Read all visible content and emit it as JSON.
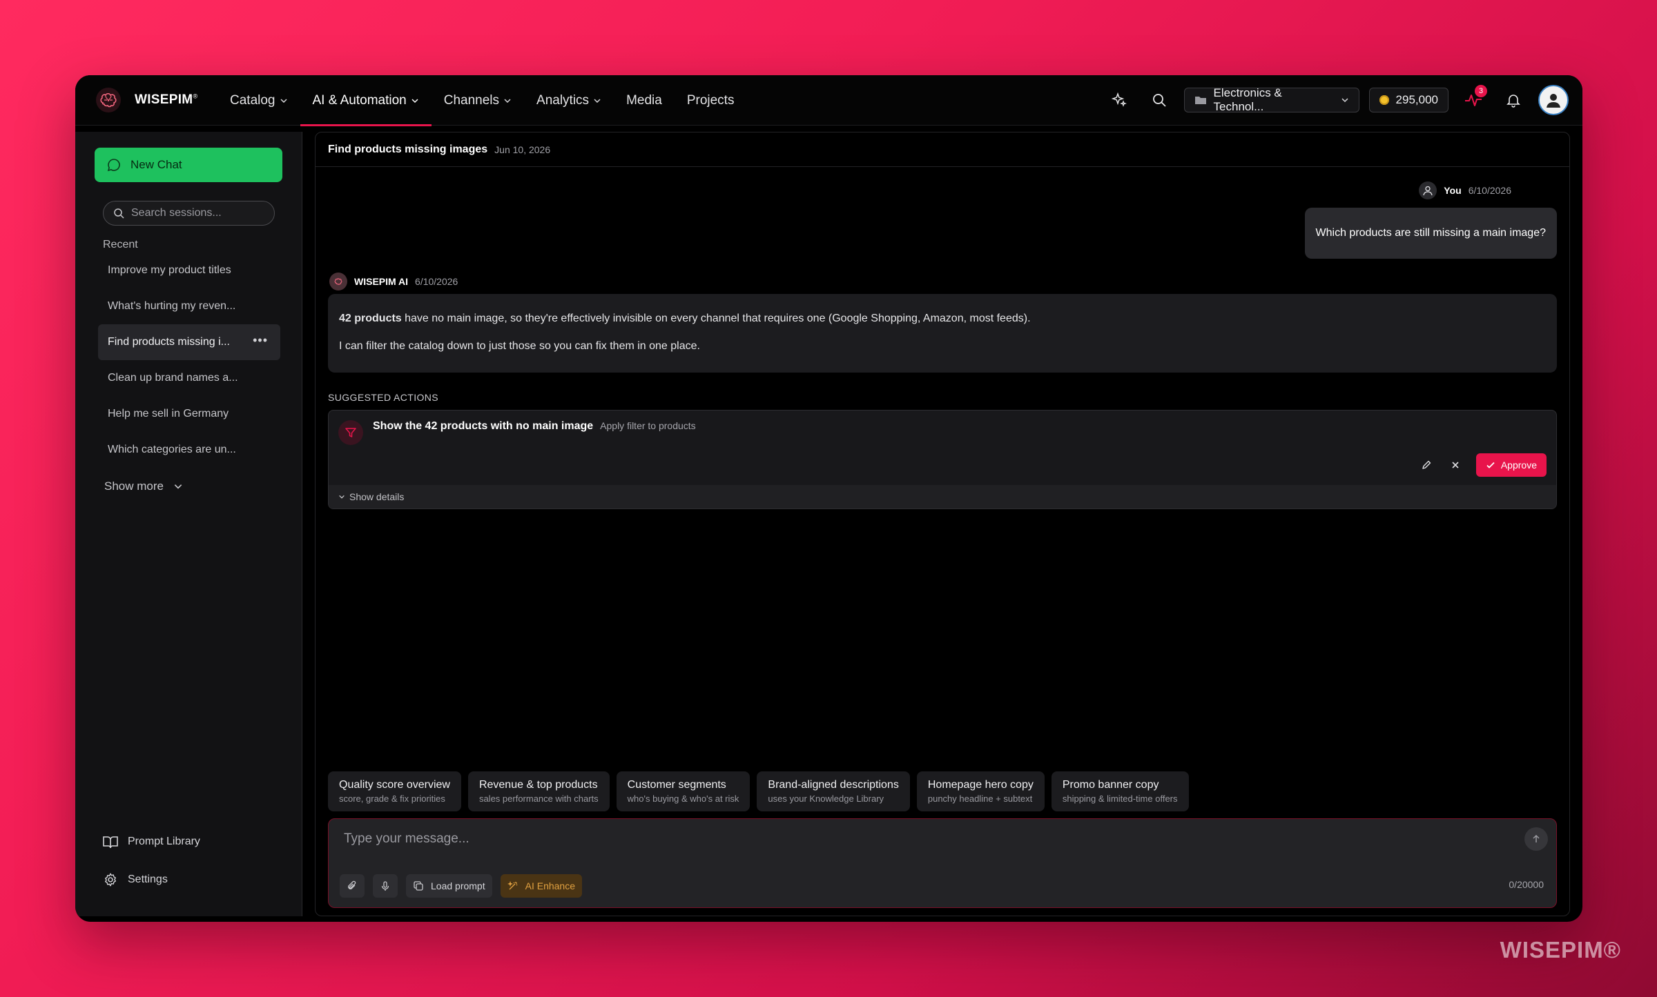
{
  "app": {
    "brand": "WISEPIM",
    "brand_mark": "®",
    "watermark": "WISEPIM®"
  },
  "nav": {
    "items": [
      {
        "label": "Catalog",
        "dropdown": true
      },
      {
        "label": "AI & Automation",
        "dropdown": true,
        "active": true
      },
      {
        "label": "Channels",
        "dropdown": true
      },
      {
        "label": "Analytics",
        "dropdown": true
      },
      {
        "label": "Media",
        "dropdown": false
      },
      {
        "label": "Projects",
        "dropdown": false
      }
    ],
    "workspace": "Electronics & Technol...",
    "credits": "295,000",
    "activity_badge": "3"
  },
  "sidebar": {
    "new_chat": "New Chat",
    "search_placeholder": "Search sessions...",
    "recent_label": "Recent",
    "sessions": [
      {
        "label": "Improve my product titles"
      },
      {
        "label": "What's hurting my reven..."
      },
      {
        "label": "Find products missing i...",
        "active": true
      },
      {
        "label": "Clean up brand names a..."
      },
      {
        "label": "Help me sell in Germany"
      },
      {
        "label": "Which categories are un..."
      }
    ],
    "show_more": "Show more",
    "prompt_library": "Prompt Library",
    "settings": "Settings"
  },
  "chat": {
    "title": "Find products missing images",
    "date": "Jun 10, 2026",
    "user_name": "You",
    "user_time": "6/10/2026",
    "user_message": "Which products are still missing a main image?",
    "ai_name": "WISEPIM AI",
    "ai_time": "6/10/2026",
    "ai_bold": "42 products",
    "ai_line1_rest": " have no main image, so they're effectively invisible on every channel that requires one (Google Shopping, Amazon, most feeds).",
    "ai_line2": "I can filter the catalog down to just those so you can fix them in one place.",
    "suggested_label": "SUGGESTED ACTIONS",
    "action_title": "Show the 42 products with no main image",
    "action_subtitle": "Apply filter to products",
    "approve": "Approve",
    "show_details": "Show details"
  },
  "chips": [
    {
      "title": "Quality score overview",
      "sub": "score, grade & fix priorities"
    },
    {
      "title": "Revenue & top products",
      "sub": "sales performance with charts"
    },
    {
      "title": "Customer segments",
      "sub": "who's buying & who's at risk"
    },
    {
      "title": "Brand-aligned descriptions",
      "sub": "uses your Knowledge Library"
    },
    {
      "title": "Homepage hero copy",
      "sub": "punchy headline + subtext"
    },
    {
      "title": "Promo banner copy",
      "sub": "shipping & limited-time offers"
    }
  ],
  "composer": {
    "placeholder": "Type your message...",
    "load_prompt": "Load prompt",
    "ai_enhance": "AI Enhance",
    "counter": "0/20000"
  },
  "colors": {
    "accent": "#e8144b",
    "green": "#1ec15e",
    "enhance": "#e0a040"
  }
}
